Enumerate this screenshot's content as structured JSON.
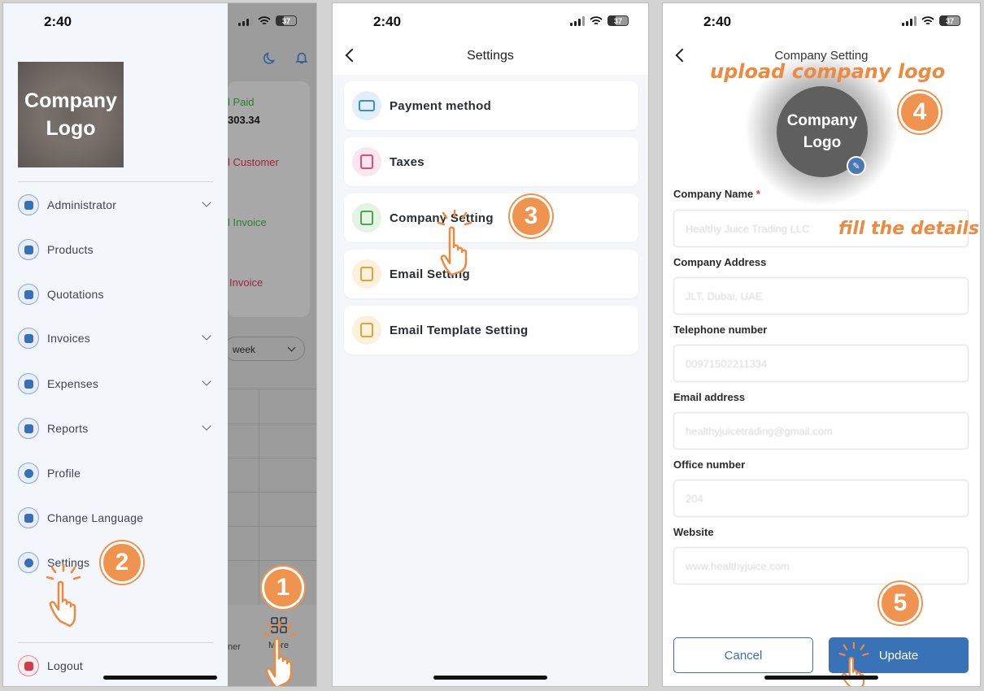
{
  "status": {
    "time": "2:40",
    "battery": "37"
  },
  "panel1": {
    "logo_text": "Company Logo",
    "menu": [
      {
        "label": "Administrator",
        "icon": "admin-icon",
        "chevron": true
      },
      {
        "label": "Products",
        "icon": "products-icon",
        "chevron": false
      },
      {
        "label": "Quotations",
        "icon": "quotations-icon",
        "chevron": false
      },
      {
        "label": "Invoices",
        "icon": "invoices-icon",
        "chevron": true
      },
      {
        "label": "Expenses",
        "icon": "expenses-icon",
        "chevron": true
      },
      {
        "label": "Reports",
        "icon": "reports-icon",
        "chevron": true
      },
      {
        "label": "Profile",
        "icon": "profile-icon",
        "chevron": false
      },
      {
        "label": "Change Language",
        "icon": "language-icon",
        "chevron": false
      },
      {
        "label": "Settings",
        "icon": "settings-icon",
        "chevron": false
      }
    ],
    "logout": "Logout",
    "background": {
      "paid_label": "l Paid",
      "paid_value": "303.34",
      "customer_label": "l Customer",
      "invoice_label": "l Invoice",
      "red_invoice_label": "Invoice",
      "filter": "week",
      "nav_more": "More",
      "nav_partial": "ner"
    },
    "step_a": "1",
    "step_b": "2"
  },
  "panel2": {
    "title": "Settings",
    "items": [
      {
        "label": "Payment method",
        "color": "#3a8fd0",
        "bg": "#e2eef9"
      },
      {
        "label": "Taxes",
        "color": "#d4507d",
        "bg": "#fbe6ee"
      },
      {
        "label": "Company Setting",
        "color": "#4aa552",
        "bg": "#e4f3e4"
      },
      {
        "label": "Email Setting",
        "color": "#e0a43c",
        "bg": "#fcf1dc"
      },
      {
        "label": "Email Template Setting",
        "color": "#e0a43c",
        "bg": "#fcf1dc"
      }
    ],
    "step": "3"
  },
  "panel3": {
    "title": "Company Setting",
    "annot_logo": "upload company logo",
    "annot_details": "fill the details",
    "avatar_text": "Company Logo",
    "fields": [
      {
        "label": "Company Name",
        "required": "*",
        "value": "Healthy Juice Trading LLC"
      },
      {
        "label": "Company Address",
        "required": "",
        "value": "JLT, Dubai, UAE"
      },
      {
        "label": "Telephone number",
        "required": "",
        "value": "00971502211334"
      },
      {
        "label": "Email address",
        "required": "",
        "value": "healthyjuicetrading@gmail.com"
      },
      {
        "label": "Office number",
        "required": "",
        "value": "204"
      },
      {
        "label": "Website",
        "required": "",
        "value": "www.healthyjuice.com"
      }
    ],
    "cancel": "Cancel",
    "update": "Update",
    "step_a": "4",
    "step_b": "5"
  },
  "colors": {
    "accent": "#f0934f",
    "primary": "#3a72b8"
  }
}
